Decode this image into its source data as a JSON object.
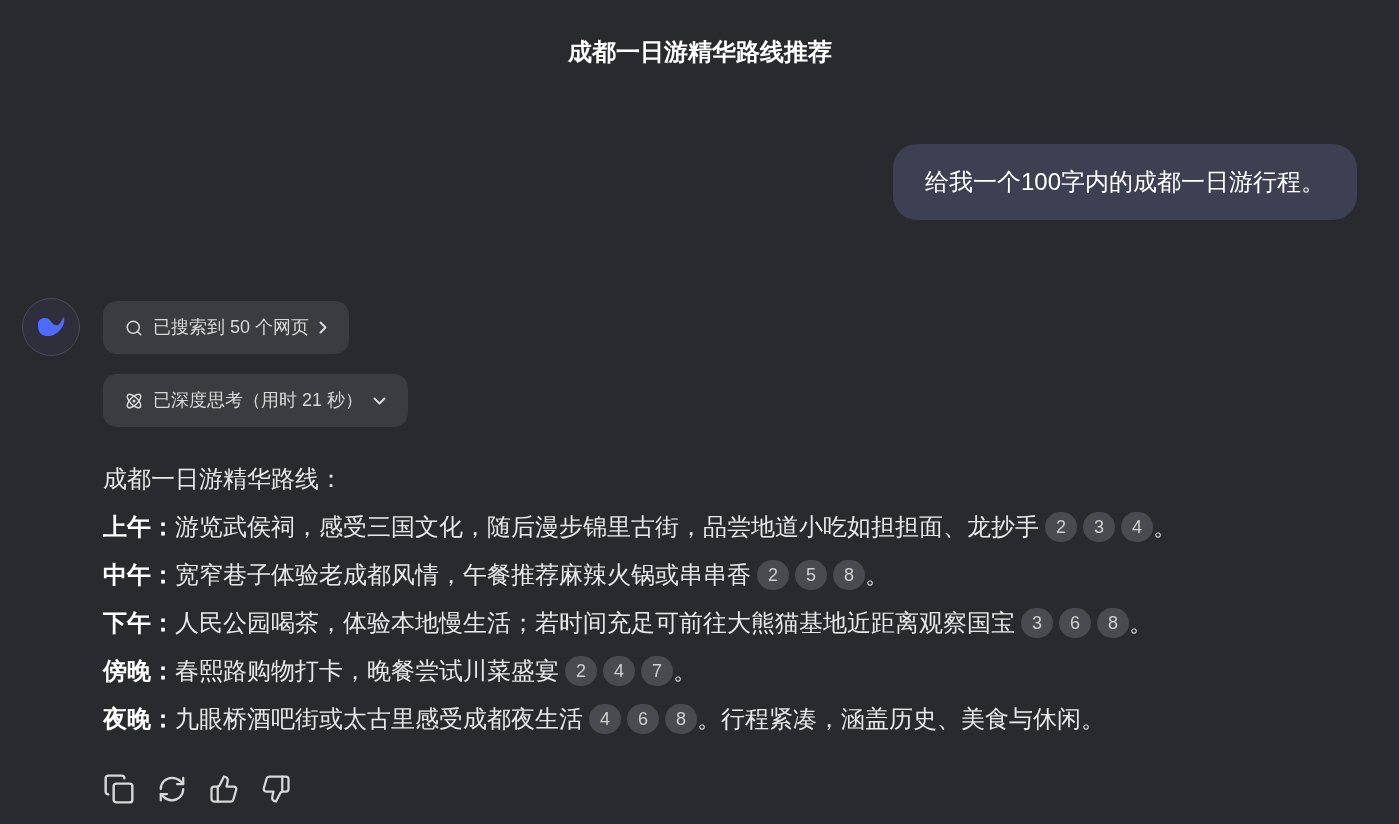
{
  "title": "成都一日游精华路线推荐",
  "user_message": "给我一个100字内的成都一日游行程。",
  "search_chip": {
    "label": "已搜索到 50 个网页"
  },
  "think_chip": {
    "label": "已深度思考（用时 21 秒）",
    "expanded": false
  },
  "answer": {
    "heading": "成都一日游精华路线：",
    "lines": [
      {
        "label": "上午：",
        "text": "游览武侯祠，感受三国文化，随后漫步锦里古街，品尝地道小吃如担担面、龙抄手",
        "citations": [
          "2",
          "3",
          "4"
        ],
        "after": "。"
      },
      {
        "label": "中午：",
        "text": "宽窄巷子体验老成都风情，午餐推荐麻辣火锅或串串香",
        "citations": [
          "2",
          "5",
          "8"
        ],
        "after": "。"
      },
      {
        "label": "下午：",
        "text": "人民公园喝茶，体验本地慢生活；若时间充足可前往大熊猫基地近距离观察国宝",
        "citations": [
          "3",
          "6",
          "8"
        ],
        "after": "。"
      },
      {
        "label": "傍晚：",
        "text": "春熙路购物打卡，晚餐尝试川菜盛宴",
        "citations": [
          "2",
          "4",
          "7"
        ],
        "after": "。"
      },
      {
        "label": "夜晚：",
        "text": "九眼桥酒吧街或太古里感受成都夜生活",
        "citations": [
          "4",
          "6",
          "8"
        ],
        "after": "。行程紧凑，涵盖历史、美食与休闲。"
      }
    ]
  }
}
